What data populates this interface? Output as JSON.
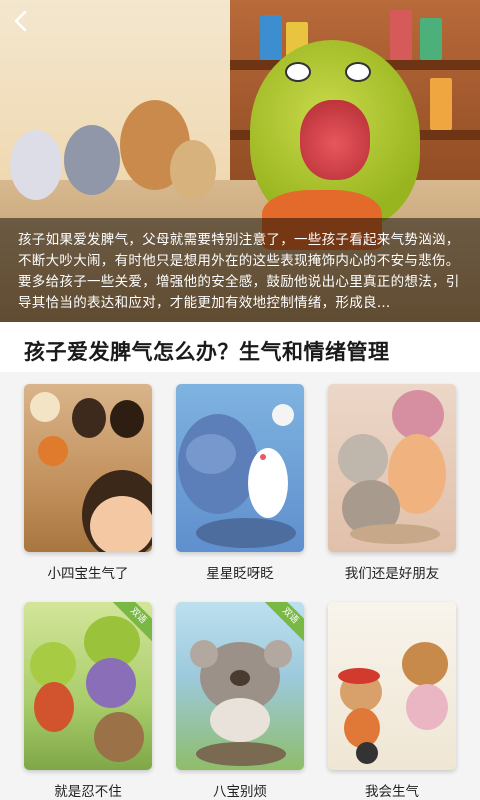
{
  "header": {
    "back_icon": "chevron-left-icon"
  },
  "hero": {
    "description": "孩子如果爱发脾气，父母就需要特别注意了，一些孩子看起来气势汹汹，不断大吵大闹，有时他只是想用外在的这些表现掩饰内心的不安与悲伤。要多给孩子一些关爱，增强他的安全感，鼓励他说出心里真正的想法，引导其恰当的表达和应对，才能更加有效地控制情绪，形成良…"
  },
  "section": {
    "title": "孩子爱发脾气怎么办？生气和情绪管理"
  },
  "books": [
    {
      "title": "小四宝生气了",
      "badge": ""
    },
    {
      "title": "星星眨呀眨",
      "badge": ""
    },
    {
      "title": "我们还是好朋友",
      "badge": ""
    },
    {
      "title": "就是忍不住",
      "badge": "双语"
    },
    {
      "title": "八宝别烦",
      "badge": "双语"
    },
    {
      "title": "我会生气",
      "badge": ""
    }
  ],
  "colors": {
    "badge_green": "#79b844",
    "caption_overlay": "rgba(0,0,0,0.48)",
    "grid_background": "#f4f4f4"
  }
}
